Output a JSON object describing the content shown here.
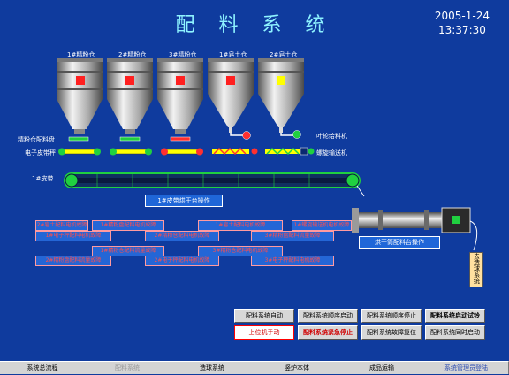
{
  "title": "配 料 系 统",
  "clock": {
    "date": "2005-1-24",
    "time": "13:37:30"
  },
  "silos": [
    {
      "label": "1#精粉仓",
      "indicator": "#ff2020"
    },
    {
      "label": "2#精粉仓",
      "indicator": "#ff2020"
    },
    {
      "label": "3#精粉仓",
      "indicator": "#ff2020"
    },
    {
      "label": "1#皂土仓",
      "indicator": "#ff2020"
    },
    {
      "label": "2#皂土仓",
      "indicator": "#ffff00"
    }
  ],
  "labels": {
    "disk_feeder": "精粉仓配料盘",
    "belt_scale": "电子皮带秤",
    "impeller": "叶轮给料机",
    "screw": "螺旋输送机",
    "belt1": "1#皮带"
  },
  "panels": {
    "belt_dryer": "1#皮带烘干台操作",
    "dryer_mix": "烘干筒配料台操作",
    "side_tag": "去造球系统"
  },
  "alarms": [
    "1#精粉盘配料电机故障",
    "1#电子秤配料电机故障",
    "1#精粉仓配料流量故障",
    "2#精粉盘配料流量故障",
    "2#精粉仓配料电机故障",
    "2#电子秤配料电机故障",
    "1#皂土配料电机故障",
    "3#精粉盘配料流量故障",
    "3#精粉仓配料电机故障",
    "3#电子秤配料电机故障",
    "2#皂土配料电机故障",
    "1#螺旋输送机电机故障"
  ],
  "buttons": {
    "auto": "配料系统自动",
    "seq_start": "配料系统顺序启动",
    "seq_stop": "配料系统顺序停止",
    "auto_test": "配料系统启动试铃",
    "manual": "上位机手动",
    "emergency": "配料系统紧急停止",
    "fault_reset": "配料系统故障复位",
    "sync_start": "配料系统同时启动"
  },
  "nav": [
    "系统总流程",
    "配料系统",
    "造球系统",
    "竖炉本体",
    "成品运输",
    "系统管理员登陆"
  ],
  "colors": {
    "background": "#0f3b9e",
    "title": "#8ef3ff",
    "alarm_text": "#ff4d4d"
  }
}
